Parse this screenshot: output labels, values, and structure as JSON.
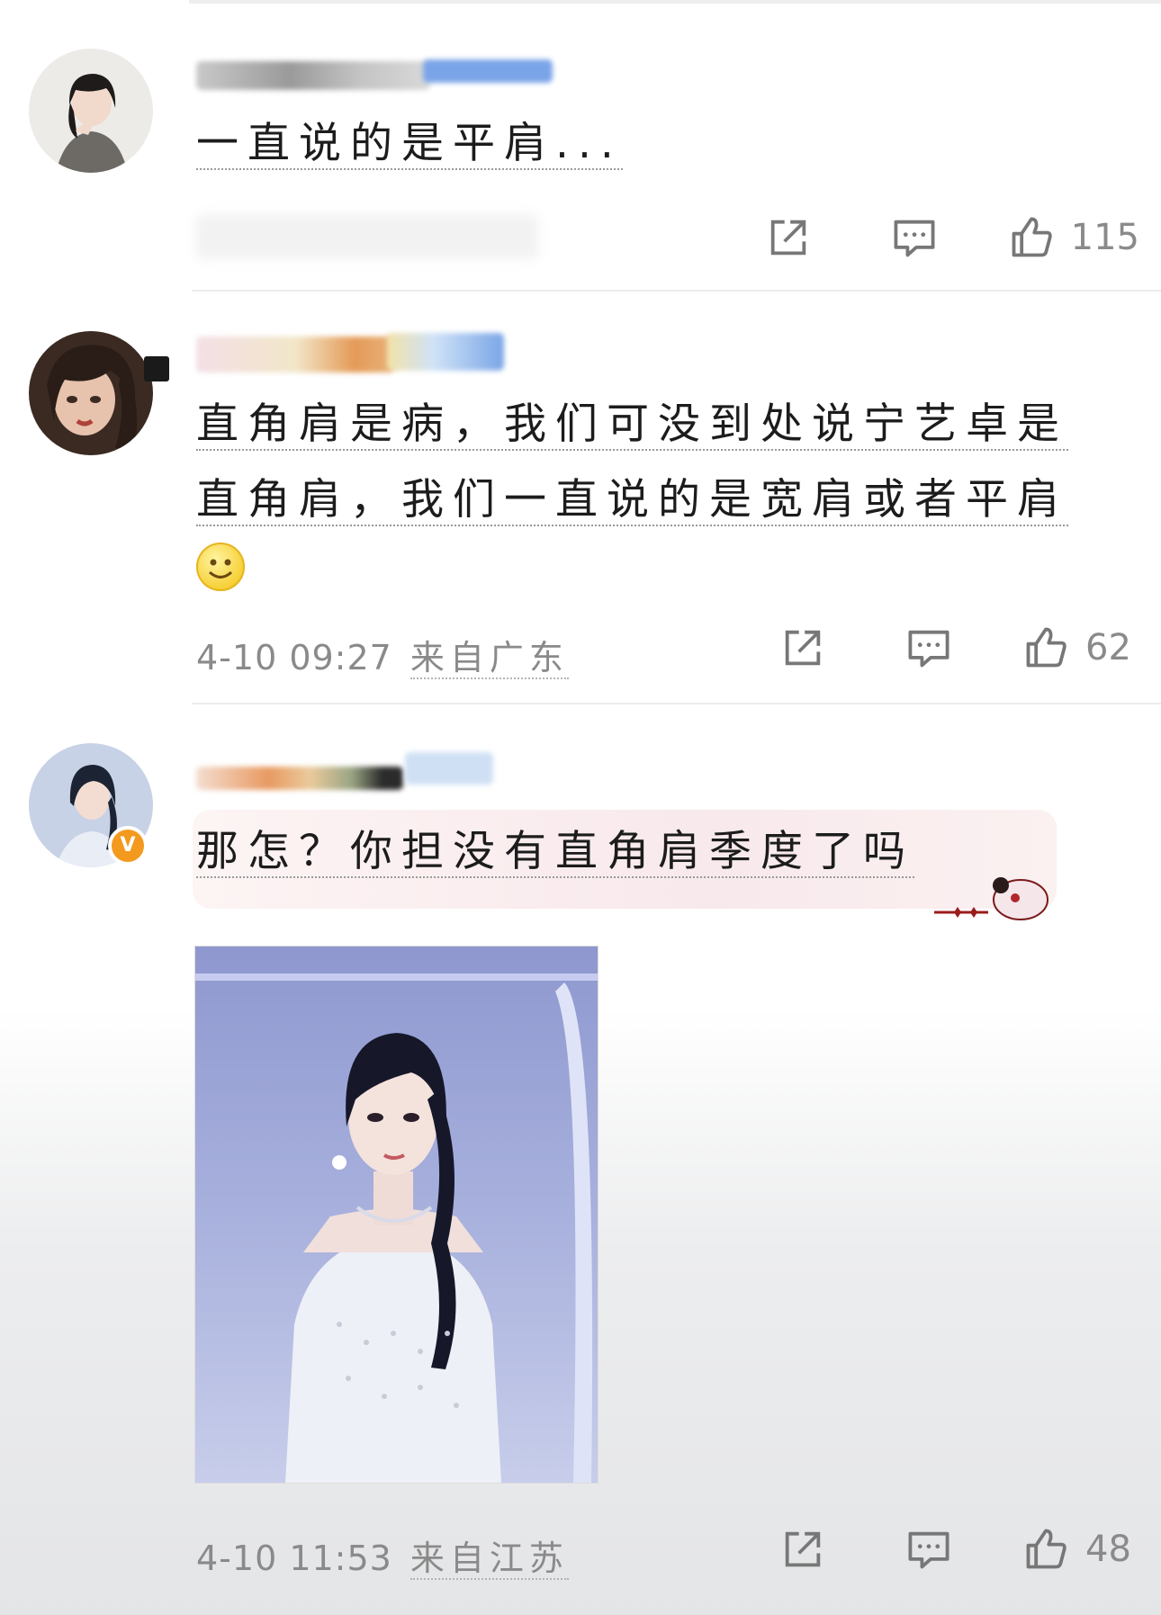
{
  "comments": [
    {
      "text": "一直说的是平肩...",
      "likes": "115",
      "avatar_icon": "user-avatar-1",
      "timestamp": "",
      "location": ""
    },
    {
      "text_line1": "直角肩是病，我们可没到处说宁艺卓是",
      "text_line2": "直角肩，我们一直说的是宽肩或者平肩",
      "emoji": "smile-emoji",
      "timestamp": "4-10 09:27",
      "location": "来自广东",
      "likes": "62",
      "avatar_icon": "user-avatar-2"
    },
    {
      "text": "那怎？你担没有直角肩季度了吗",
      "timestamp": "4-10 11:53",
      "location": "来自江苏",
      "likes": "48",
      "avatar_icon": "user-avatar-3",
      "badge": "V",
      "image": "performer-photo"
    }
  ],
  "icons": {
    "share": "share-icon",
    "reply": "reply-icon",
    "like": "like-icon"
  },
  "colors": {
    "text": "#1c1c1c",
    "meta": "#8a8a8a",
    "badge": "#f39a1e"
  }
}
